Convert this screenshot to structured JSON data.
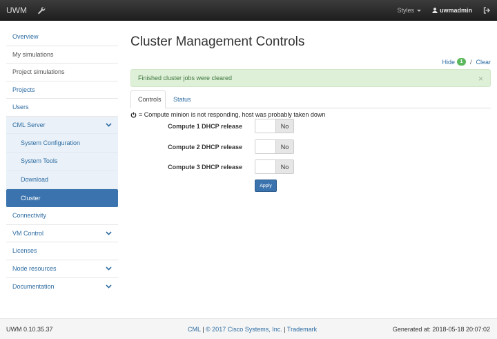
{
  "navbar": {
    "brand": "UWM",
    "styles_label": "Styles",
    "username": "uwmadmin"
  },
  "sidebar": {
    "items": [
      {
        "label": "Overview"
      },
      {
        "label": "My simulations"
      },
      {
        "label": "Project simulations"
      },
      {
        "label": "Projects"
      },
      {
        "label": "Users"
      },
      {
        "label": "CML Server"
      },
      {
        "label": "System Configuration"
      },
      {
        "label": "System Tools"
      },
      {
        "label": "Download"
      },
      {
        "label": "Cluster"
      },
      {
        "label": "Connectivity"
      },
      {
        "label": "VM Control"
      },
      {
        "label": "Licenses"
      },
      {
        "label": "Node resources"
      },
      {
        "label": "Documentation"
      }
    ]
  },
  "main": {
    "title": "Cluster Management Controls",
    "hide_label": "Hide",
    "hide_count": "1",
    "separator": "/",
    "clear_label": "Clear",
    "alert_text": "Finished cluster jobs were cleared",
    "alert_close": "×",
    "tabs": [
      {
        "label": "Controls"
      },
      {
        "label": "Status"
      }
    ],
    "note": "= Compute minion is not responding, host was probably taken down",
    "rows": [
      {
        "label": "Compute 1 DHCP release",
        "value": "No"
      },
      {
        "label": "Compute 2 DHCP release",
        "value": "No"
      },
      {
        "label": "Compute 3 DHCP release",
        "value": "No"
      }
    ],
    "apply_label": "Apply"
  },
  "footer": {
    "version": "UWM 0.10.35.37",
    "cml_link": "CML",
    "bar1": "|",
    "copyright": "© 2017 Cisco Systems, Inc.",
    "bar2": "|",
    "trademark": "Trademark",
    "generated": "Generated at: 2018-05-18 20:07:02"
  },
  "colors": {
    "link": "#2d6ca2",
    "active": "#3a73ad",
    "alert_bg": "#dff0d8",
    "badge": "#5cb85c"
  }
}
